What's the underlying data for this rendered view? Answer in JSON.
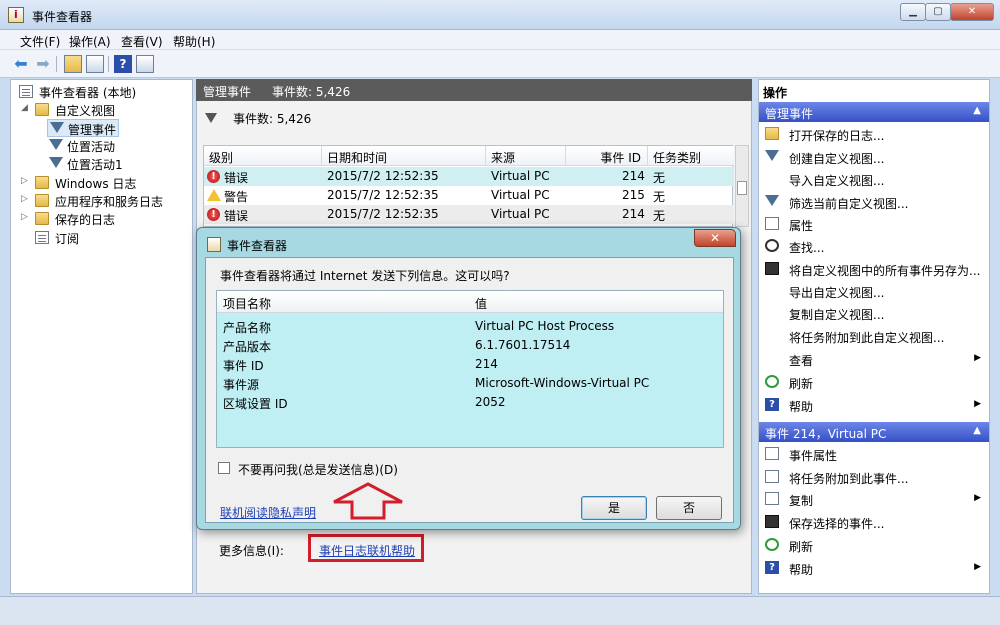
{
  "window": {
    "title": "事件查看器"
  },
  "menu": [
    "文件(F)",
    "操作(A)",
    "查看(V)",
    "帮助(H)"
  ],
  "tree": {
    "root": "事件查看器 (本地)",
    "custom_views": "自定义视图",
    "managed_events": "管理事件",
    "location_activity": "位置活动",
    "location_activity1": "位置活动1",
    "windows_logs": "Windows 日志",
    "app_service_logs": "应用程序和服务日志",
    "saved_logs": "保存的日志",
    "subscriptions": "订阅"
  },
  "middle": {
    "header_title": "管理事件",
    "header_count": "事件数: 5,426",
    "filter_count": "事件数: 5,426",
    "columns": [
      "级别",
      "日期和时间",
      "来源",
      "事件 ID",
      "任务类别"
    ],
    "rows": [
      {
        "level": "错误",
        "level_icon": "error-icon",
        "datetime": "2015/7/2 12:52:35",
        "source": "Virtual PC",
        "event_id": "214",
        "task": "无"
      },
      {
        "level": "警告",
        "level_icon": "warning-icon",
        "datetime": "2015/7/2 12:52:35",
        "source": "Virtual PC",
        "event_id": "215",
        "task": "无"
      },
      {
        "level": "错误",
        "level_icon": "error-icon",
        "datetime": "2015/7/2 12:52:35",
        "source": "Virtual PC",
        "event_id": "214",
        "task": "无"
      }
    ],
    "more_info_label": "更多信息(I):",
    "more_info_link": "事件日志联机帮助"
  },
  "actions": {
    "title": "操作",
    "section1": "管理事件",
    "items1": [
      {
        "label": "打开保存的日志...",
        "icon": "folder-icon"
      },
      {
        "label": "创建自定义视图...",
        "icon": "filter-icon"
      },
      {
        "label": "导入自定义视图...",
        "icon": ""
      },
      {
        "label": "筛选当前自定义视图...",
        "icon": "filter-icon"
      },
      {
        "label": "属性",
        "icon": "doc-icon"
      },
      {
        "label": "查找...",
        "icon": "find-icon"
      },
      {
        "label": "将自定义视图中的所有事件另存为...",
        "icon": "disk-icon"
      },
      {
        "label": "导出自定义视图...",
        "icon": ""
      },
      {
        "label": "复制自定义视图...",
        "icon": ""
      },
      {
        "label": "将任务附加到此自定义视图...",
        "icon": ""
      },
      {
        "label": "查看",
        "icon": "",
        "submenu": true
      },
      {
        "label": "刷新",
        "icon": "refresh-icon"
      },
      {
        "label": "帮助",
        "icon": "help-icon",
        "submenu": true
      }
    ],
    "section2": "事件 214，Virtual PC",
    "items2": [
      {
        "label": "事件属性",
        "icon": "doc-icon"
      },
      {
        "label": "将任务附加到此事件...",
        "icon": "doc-icon"
      },
      {
        "label": "复制",
        "icon": "doc-icon",
        "submenu": true
      },
      {
        "label": "保存选择的事件...",
        "icon": "disk-icon"
      },
      {
        "label": "刷新",
        "icon": "refresh-icon"
      },
      {
        "label": "帮助",
        "icon": "help-icon",
        "submenu": true
      }
    ]
  },
  "dialog": {
    "title": "事件查看器",
    "question": "事件查看器将通过 Internet 发送下列信息。这可以吗?",
    "col_name": "项目名称",
    "col_value": "值",
    "rows": [
      {
        "name": "产品名称",
        "value": "Virtual PC Host Process"
      },
      {
        "name": "产品版本",
        "value": "6.1.7601.17514"
      },
      {
        "name": "事件 ID",
        "value": "214"
      },
      {
        "name": "事件源",
        "value": "Microsoft-Windows-Virtual PC"
      },
      {
        "name": "区域设置 ID",
        "value": "2052"
      }
    ],
    "checkbox_label": "不要再问我(总是发送信息)(D)",
    "privacy_link": "联机阅读隐私声明",
    "yes": "是",
    "no": "否"
  },
  "colors": {
    "annotation_red": "#d21d2b",
    "header_bar": "#3550c6",
    "selection": "#cfeff3"
  }
}
